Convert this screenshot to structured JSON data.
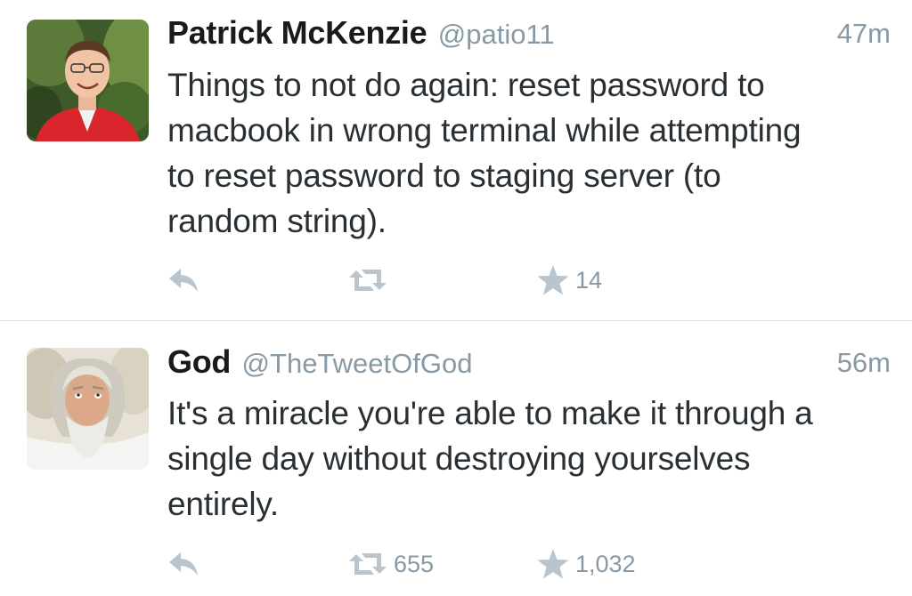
{
  "tweets": [
    {
      "author": {
        "name": "Patrick McKenzie",
        "handle": "@patio11"
      },
      "timestamp": "47m",
      "text_lines": [
        "Things to not do again: reset password to",
        "macbook in wrong terminal while attempting",
        "to reset password to staging server (to",
        "random string)."
      ],
      "actions": {
        "reply_icon": "reply-icon",
        "retweet_icon": "retweet-icon",
        "retweet_count": "",
        "favorite_icon": "star-icon",
        "favorite_count": "14"
      }
    },
    {
      "author": {
        "name": "God",
        "handle": "@TheTweetOfGod"
      },
      "timestamp": "56m",
      "text_lines": [
        "It's a miracle you're able to make it through a",
        "single day without destroying yourselves",
        "entirely."
      ],
      "actions": {
        "reply_icon": "reply-icon",
        "retweet_icon": "retweet-icon",
        "retweet_count": "655",
        "favorite_icon": "star-icon",
        "favorite_count": "1,032"
      }
    }
  ],
  "colors": {
    "secondary_text": "#8899a6",
    "body_text": "#292f33",
    "divider": "#dcdfe3"
  }
}
